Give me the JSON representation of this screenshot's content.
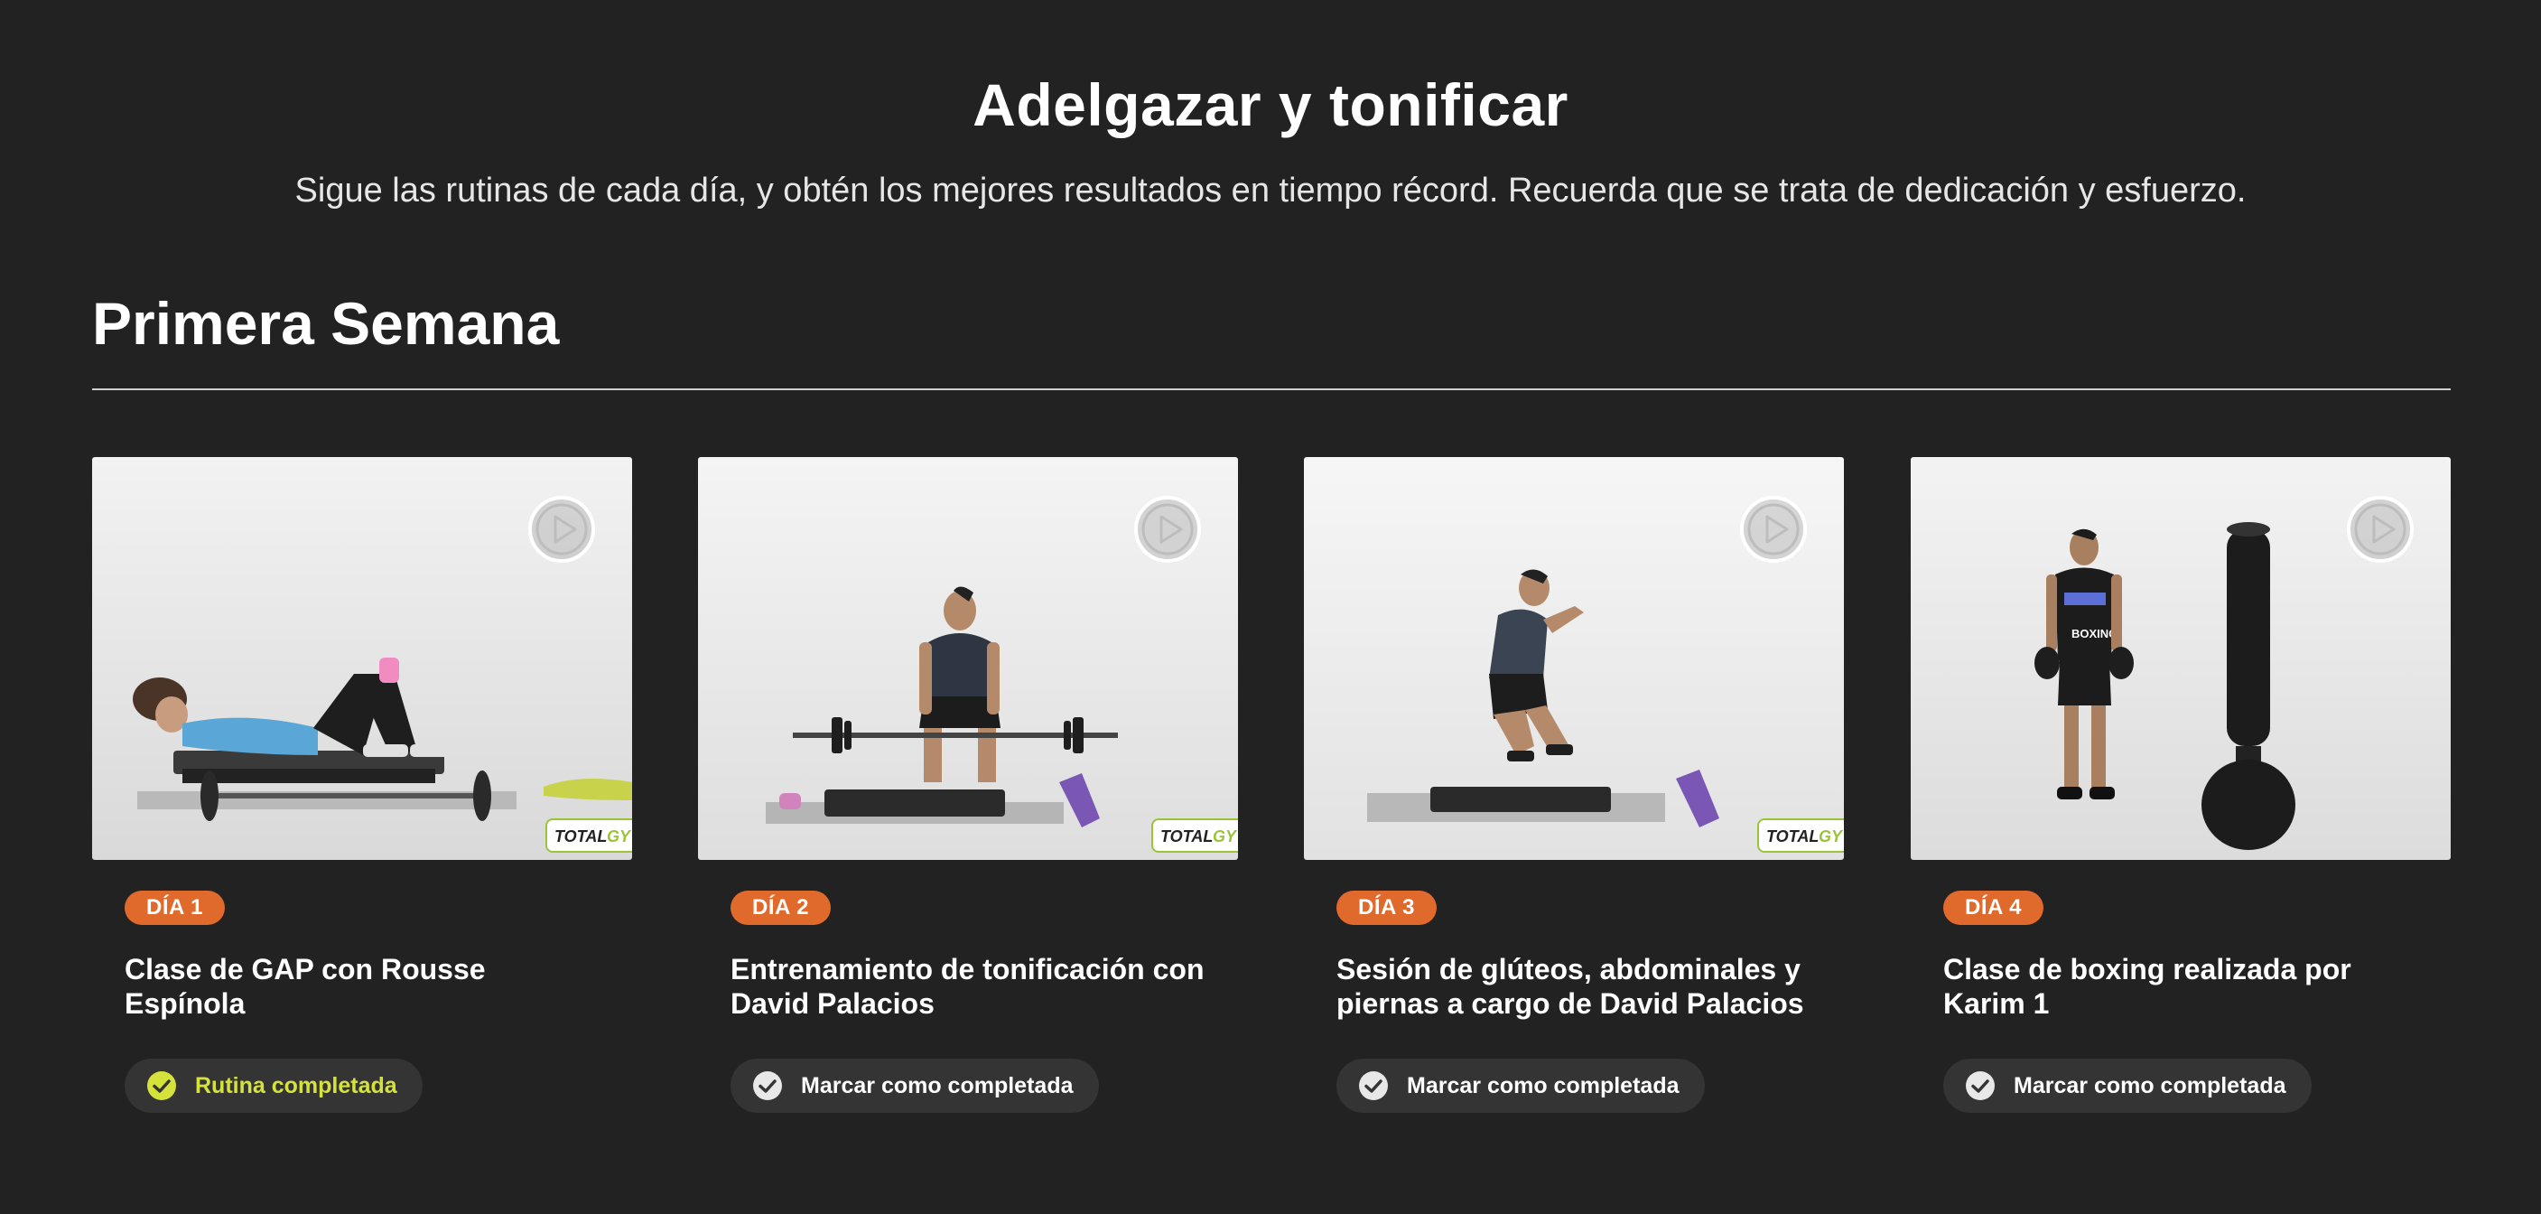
{
  "hero": {
    "title": "Adelgazar y tonificar",
    "subtitle": "Sigue las rutinas de cada día, y obtén los mejores resultados en tiempo récord. Recuerda que se trata de dedicación y esfuerzo."
  },
  "section": {
    "title": "Primera Semana"
  },
  "cards": [
    {
      "day_label": "DÍA 1",
      "title": "Clase de GAP con Rousse Espínola",
      "status_label": "Rutina completada",
      "status_icon": "check-circle-filled-icon",
      "completed": true,
      "has_brand_logo": true
    },
    {
      "day_label": "DÍA 2",
      "title": "Entrenamiento de tonificación con David Palacios",
      "status_label": "Marcar como completada",
      "status_icon": "check-circle-icon",
      "completed": false,
      "has_brand_logo": true
    },
    {
      "day_label": "DÍA 3",
      "title": "Sesión de glúteos, abdominales y piernas a cargo de David Palacios",
      "status_label": "Marcar como completada",
      "status_icon": "check-circle-icon",
      "completed": false,
      "has_brand_logo": true
    },
    {
      "day_label": "DÍA 4",
      "title": "Clase de boxing realizada por Karim 1",
      "status_label": "Marcar como completada",
      "status_icon": "check-circle-icon",
      "completed": false,
      "has_brand_logo": false
    }
  ],
  "brand": {
    "logo_text": "TOTALGYM"
  },
  "colors": {
    "background": "#222222",
    "badge": "#e06a2c",
    "completed_accent": "#d6e23c",
    "status_button": "#343434"
  }
}
